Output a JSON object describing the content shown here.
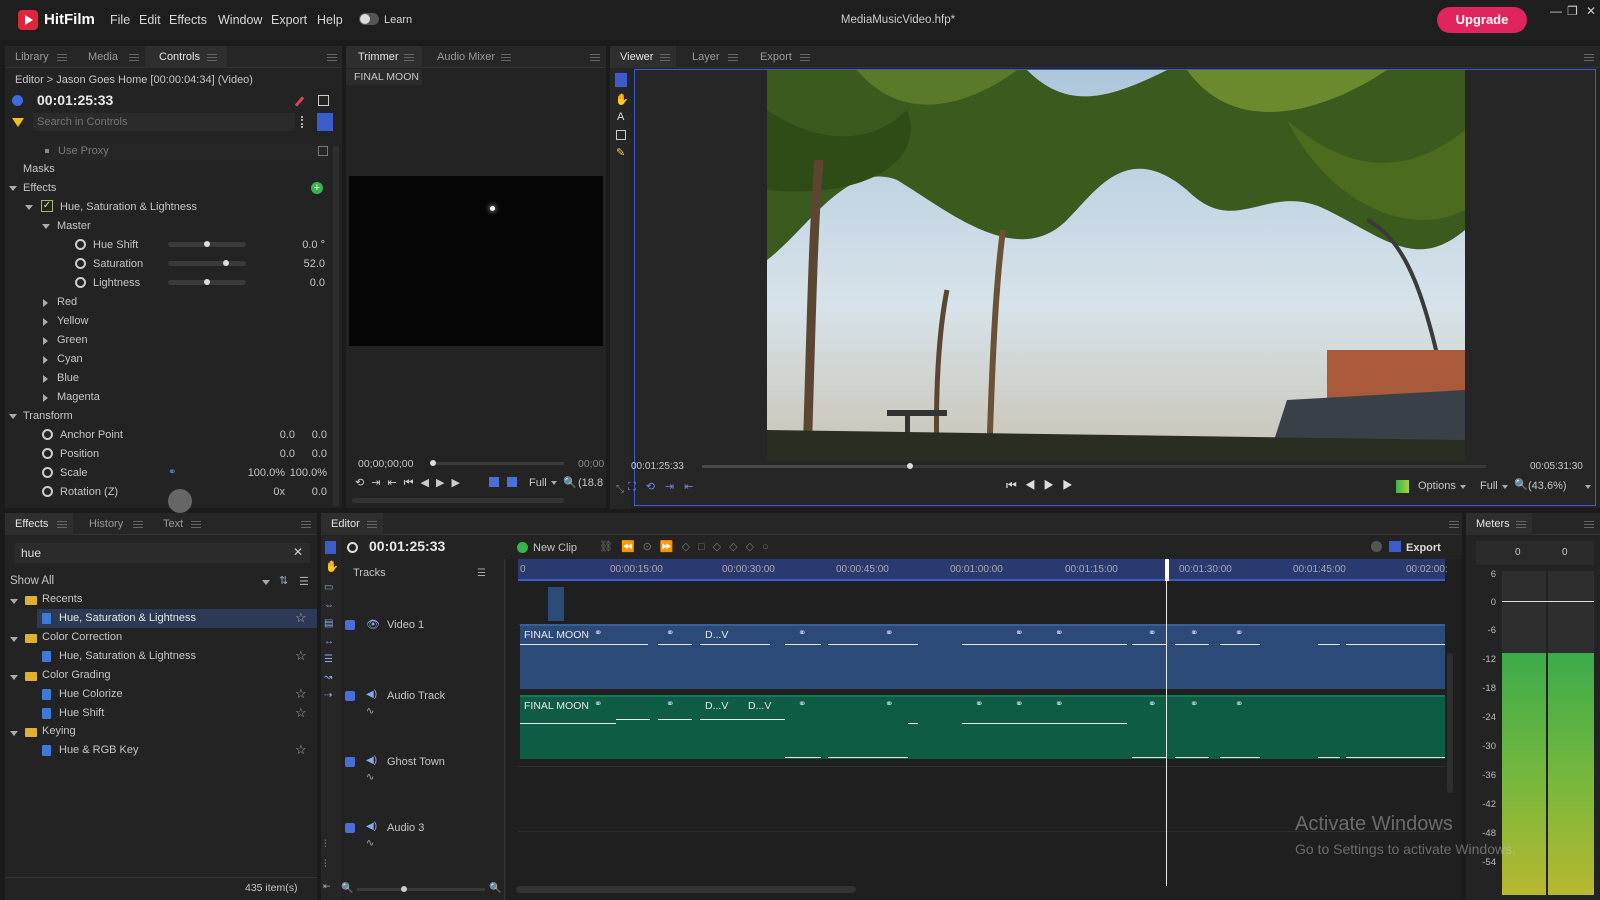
{
  "app": {
    "name": "HitFilm",
    "project_title": "MediaMusicVideo.hfp*",
    "upgrade_label": "Upgrade",
    "learn_label": "Learn"
  },
  "menu": [
    "File",
    "Edit",
    "Effects",
    "Window",
    "Export",
    "Help"
  ],
  "window_controls": {
    "minimize": "—",
    "maximize": "❐",
    "close": "✕"
  },
  "left_top_panel": {
    "tabs": [
      "Library",
      "Media",
      "Controls"
    ],
    "breadcrumb": "Editor > Jason Goes Home [00:00:04:34] (Video)",
    "timecode": "00:01:25:33",
    "search_placeholder": "Search in Controls",
    "use_proxy": "Use Proxy",
    "masks": "Masks",
    "effects": "Effects",
    "effect_name": "Hue, Saturation & Lightness",
    "master": "Master",
    "params": [
      {
        "name": "Hue Shift",
        "value": "0.0 °",
        "level": 0.5
      },
      {
        "name": "Saturation",
        "value": "52.0",
        "level": 0.74
      },
      {
        "name": "Lightness",
        "value": "0.0",
        "level": 0.5
      }
    ],
    "color_groups": [
      "Red",
      "Yellow",
      "Green",
      "Cyan",
      "Blue",
      "Magenta"
    ],
    "transform": "Transform",
    "transform_params": [
      {
        "name": "Anchor Point",
        "v1": "0.0",
        "v2": "0.0"
      },
      {
        "name": "Position",
        "v1": "0.0",
        "v2": "0.0"
      },
      {
        "name": "Scale",
        "v1": "100.0%",
        "v2": "100.0%"
      },
      {
        "name": "Rotation (Z)",
        "v1": "0x",
        "v2": "0.0"
      }
    ]
  },
  "trimmer": {
    "tabs": [
      "Trimmer",
      "Audio Mixer"
    ],
    "clip_name": "FINAL MOON",
    "timecode": "00;00;00;00",
    "timecode_end": "00;00",
    "quality": "Full",
    "zoom": "(18.8"
  },
  "viewer": {
    "tabs": [
      "Viewer",
      "Layer",
      "Export"
    ],
    "timecode": "00:01:25:33",
    "duration": "00:05:31:30",
    "options_label": "Options",
    "quality": "Full",
    "zoom": "(43.6%)",
    "progress": 0.265
  },
  "effects_panel": {
    "tabs": [
      "Effects",
      "History",
      "Text"
    ],
    "search_value": "hue",
    "filter": "Show All",
    "item_count": "435 item(s)",
    "tree": [
      {
        "type": "folder",
        "label": "Recents"
      },
      {
        "type": "item",
        "label": "Hue, Saturation & Lightness",
        "selected": true
      },
      {
        "type": "folder",
        "label": "Color Correction"
      },
      {
        "type": "item",
        "label": "Hue, Saturation & Lightness"
      },
      {
        "type": "folder",
        "label": "Color Grading"
      },
      {
        "type": "item",
        "label": "Hue Colorize"
      },
      {
        "type": "item",
        "label": "Hue Shift"
      },
      {
        "type": "folder",
        "label": "Keying"
      },
      {
        "type": "item",
        "label": "Hue & RGB Key"
      }
    ]
  },
  "editor": {
    "tab": "Editor",
    "timecode": "00:01:25:33",
    "new_clip": "New Clip",
    "export_label": "Export",
    "tracks_label": "Tracks",
    "ruler": [
      "0",
      "00:00:15:00",
      "00:00:30:00",
      "00:00:45:00",
      "00:01:00:00",
      "00:01:15:00",
      "00:01:30:00",
      "00:01:45:00",
      "00:02:00:"
    ],
    "tracks": [
      {
        "name": "Video 1",
        "kind": "video"
      },
      {
        "name": "Audio Track",
        "kind": "audio"
      },
      {
        "name": "Ghost Town",
        "kind": "audio"
      },
      {
        "name": "Audio 3",
        "kind": "audio"
      }
    ],
    "video_clip_labels": [
      "FINAL MOON",
      "D...V"
    ],
    "audio_clip_labels": [
      "FINAL MOON",
      "D...V",
      "D...V"
    ]
  },
  "meters": {
    "tab": "Meters",
    "channels": [
      "0",
      "0"
    ],
    "scale": [
      "6",
      "0",
      "-6",
      "-12",
      "-18",
      "-24",
      "-30",
      "-36",
      "-42",
      "-48",
      "-54"
    ]
  },
  "watermark": {
    "line1": "Activate Windows",
    "line2": "Go to Settings to activate Windows."
  },
  "colors": {
    "accent": "#e0245e",
    "brand": "#e0243c",
    "video_clip": "#2c4a78",
    "audio_clip": "#0e5c44",
    "selection_blue": "#3d5ccc"
  }
}
